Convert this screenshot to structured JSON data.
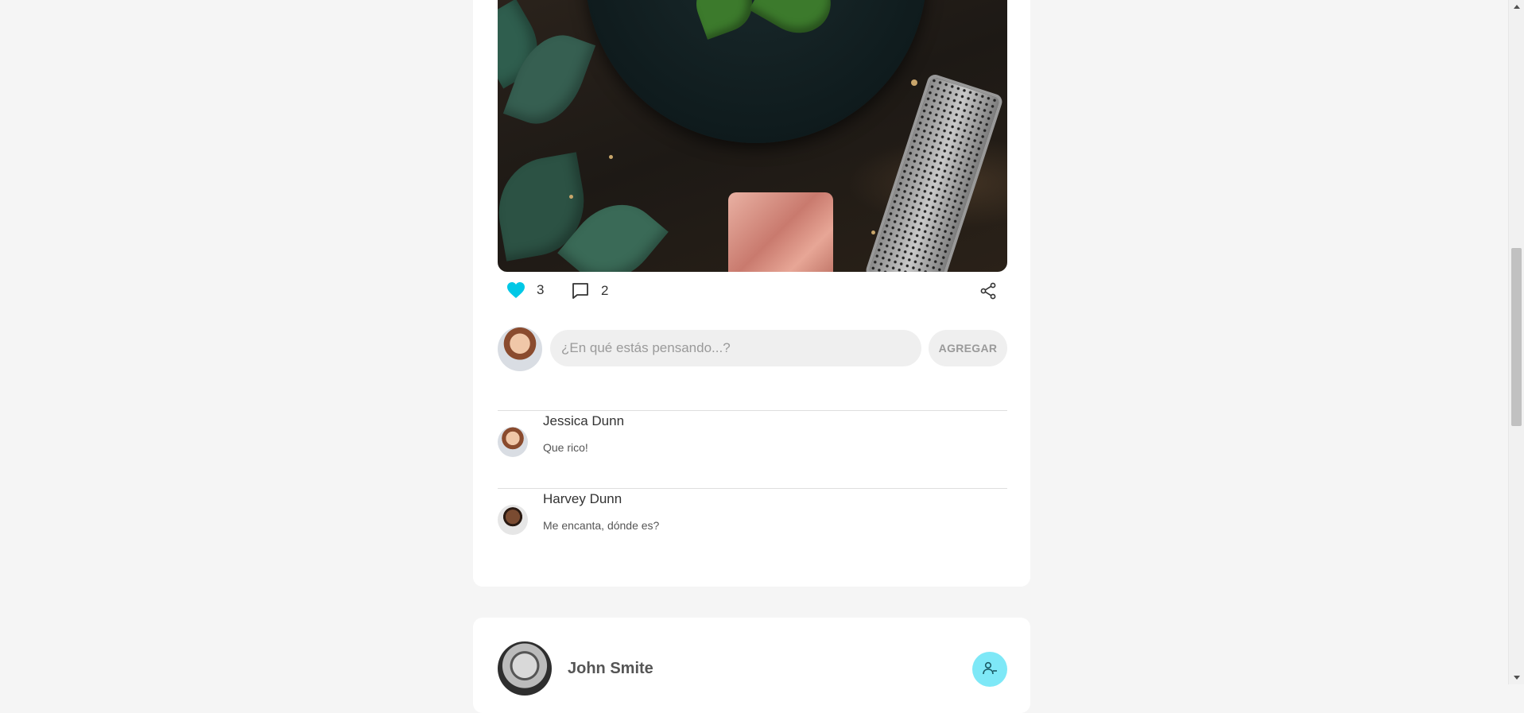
{
  "post": {
    "image_alt": "Food photo",
    "likes_count": "3",
    "comments_count": "2"
  },
  "composer": {
    "placeholder": "¿En qué estás pensando...?",
    "button_label": "AGREGAR"
  },
  "comments": [
    {
      "name": "Jessica Dunn",
      "text": "Que rico!"
    },
    {
      "name": "Harvey Dunn",
      "text": "Me encanta, dónde es?"
    }
  ],
  "next_post": {
    "author": "John Smite"
  },
  "colors": {
    "accent": "#00c8e6",
    "follow_bg": "#7ee8f7"
  },
  "icons": {
    "like": "heart-icon",
    "comment": "comment-icon",
    "share": "share-icon",
    "follow": "user-minus-icon"
  }
}
